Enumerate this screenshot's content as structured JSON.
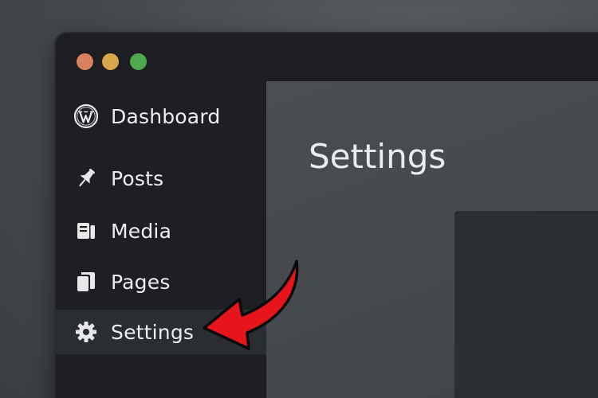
{
  "window": {
    "controls": [
      {
        "name": "close",
        "color": "#d9805d"
      },
      {
        "name": "minimize",
        "color": "#d9a64a"
      },
      {
        "name": "maximize",
        "color": "#4fa94f"
      }
    ]
  },
  "sidebar": {
    "items": [
      {
        "label": "Dashboard",
        "icon": "wordpress-logo-icon"
      },
      {
        "label": "Posts",
        "icon": "pushpin-icon"
      },
      {
        "label": "Media",
        "icon": "media-icon"
      },
      {
        "label": "Pages",
        "icon": "pages-icon"
      },
      {
        "label": "Settings",
        "icon": "gear-icon",
        "active": true
      }
    ]
  },
  "main": {
    "title": "Settings"
  },
  "annotation": {
    "arrow_color": "#e8141b",
    "points_to": "Settings"
  },
  "colors": {
    "sidebar_bg": "#1d1f22",
    "active_item_bg": "#2a2d31",
    "main_bg": "#45494d",
    "text": "#eceef0"
  }
}
